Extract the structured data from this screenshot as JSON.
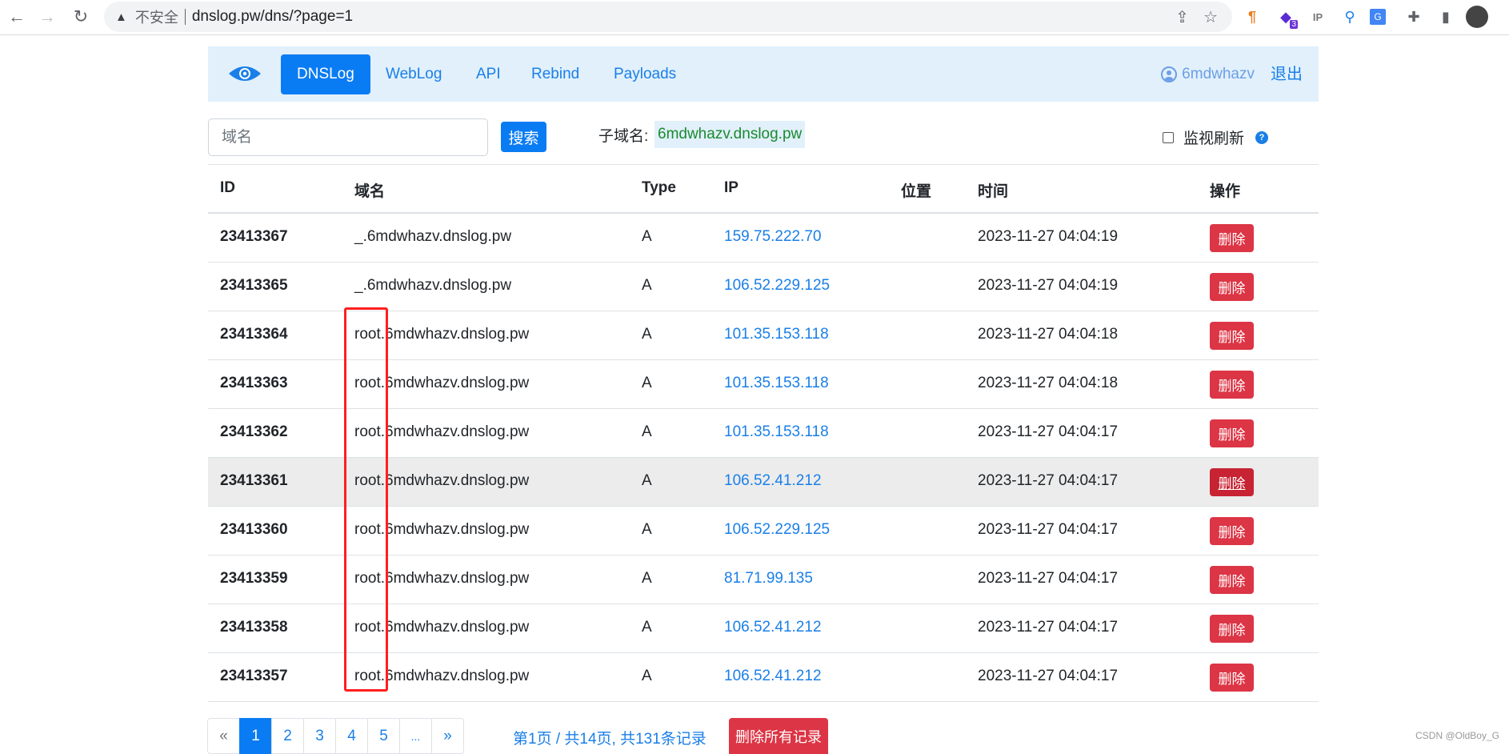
{
  "browser": {
    "back_icon": "arrow-left",
    "forward_icon": "arrow-right",
    "reload_icon": "reload",
    "security_label": "不安全",
    "url": "dnslog.pw/dns/?page=1",
    "extensions": [
      {
        "name": "pilcrow-extension-icon",
        "glyph": "¶"
      },
      {
        "name": "layers-extension-icon",
        "glyph": "◆",
        "badge": "3"
      },
      {
        "name": "ip-extension-icon",
        "glyph": "IP"
      },
      {
        "name": "pin-extension-icon",
        "glyph": "⚲"
      },
      {
        "name": "translate-extension-icon",
        "glyph": "G"
      },
      {
        "name": "puzzle-extension-icon",
        "glyph": "✚"
      },
      {
        "name": "sidepanel-icon",
        "glyph": "▮"
      }
    ]
  },
  "navbar": {
    "brand_icon": "eye-icon",
    "items": [
      {
        "label": "DNSLog",
        "active": true
      },
      {
        "label": "WebLog",
        "active": false
      },
      {
        "label": "API",
        "active": false
      },
      {
        "label": "Rebind",
        "active": false
      },
      {
        "label": "Payloads",
        "active": false
      }
    ],
    "username": "6mdwhazv",
    "logout_label": "退出"
  },
  "toolbar": {
    "search_placeholder": "域名",
    "search_value": "",
    "search_label": "搜索",
    "subdomain_label": "子域名:",
    "subdomain_value": "6mdwhazv.dnslog.pw",
    "monitor_label": "监视刷新",
    "monitor_checked": false,
    "help_glyph": "?"
  },
  "table": {
    "headers": [
      "ID",
      "域名",
      "Type",
      "IP",
      "位置",
      "时间",
      "操作"
    ],
    "delete_label": "删除",
    "rows": [
      {
        "id": "23413367",
        "domain": "_.6mdwhazv.dnslog.pw",
        "type": "A",
        "ip": "159.75.222.70",
        "location": "",
        "time": "2023-11-27 04:04:19"
      },
      {
        "id": "23413365",
        "domain": "_.6mdwhazv.dnslog.pw",
        "type": "A",
        "ip": "106.52.229.125",
        "location": "",
        "time": "2023-11-27 04:04:19"
      },
      {
        "id": "23413364",
        "domain": "root.6mdwhazv.dnslog.pw",
        "type": "A",
        "ip": "101.35.153.118",
        "location": "",
        "time": "2023-11-27 04:04:18"
      },
      {
        "id": "23413363",
        "domain": "root.6mdwhazv.dnslog.pw",
        "type": "A",
        "ip": "101.35.153.118",
        "location": "",
        "time": "2023-11-27 04:04:18"
      },
      {
        "id": "23413362",
        "domain": "root.6mdwhazv.dnslog.pw",
        "type": "A",
        "ip": "101.35.153.118",
        "location": "",
        "time": "2023-11-27 04:04:17"
      },
      {
        "id": "23413361",
        "domain": "root.6mdwhazv.dnslog.pw",
        "type": "A",
        "ip": "106.52.41.212",
        "location": "",
        "time": "2023-11-27 04:04:17",
        "hover": true
      },
      {
        "id": "23413360",
        "domain": "root.6mdwhazv.dnslog.pw",
        "type": "A",
        "ip": "106.52.229.125",
        "location": "",
        "time": "2023-11-27 04:04:17"
      },
      {
        "id": "23413359",
        "domain": "root.6mdwhazv.dnslog.pw",
        "type": "A",
        "ip": "81.71.99.135",
        "location": "",
        "time": "2023-11-27 04:04:17"
      },
      {
        "id": "23413358",
        "domain": "root.6mdwhazv.dnslog.pw",
        "type": "A",
        "ip": "106.52.41.212",
        "location": "",
        "time": "2023-11-27 04:04:17"
      },
      {
        "id": "23413357",
        "domain": "root.6mdwhazv.dnslog.pw",
        "type": "A",
        "ip": "106.52.41.212",
        "location": "",
        "time": "2023-11-27 04:04:17"
      }
    ]
  },
  "pagination": {
    "prev": "«",
    "pages": [
      "1",
      "2",
      "3",
      "4",
      "5",
      "..."
    ],
    "current": "1",
    "next": "»",
    "info": "第1页 / 共14页, 共131条记录",
    "delete_all_label": "删除所有记录"
  },
  "annotation": {
    "color": "#ff1f1f",
    "highlights": "root subdomain prefix"
  },
  "watermark": "CSDN @OldBoy_G",
  "colors": {
    "primary": "#0a7cf3",
    "danger": "#dc3545",
    "navbar_bg": "#e1f0fb",
    "subdomain_text": "#1b8a2e"
  }
}
